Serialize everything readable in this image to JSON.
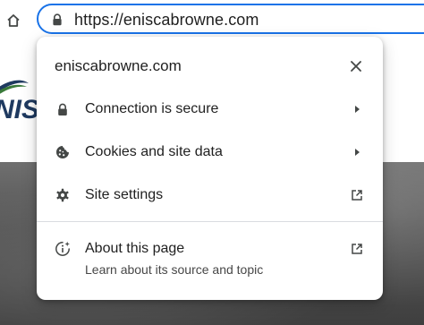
{
  "toolbar": {
    "home_icon": "home-icon",
    "lock_icon": "lock-icon",
    "url": "https://eniscabrowne.com",
    "accent": "#1a73e8"
  },
  "popup": {
    "title": "eniscabrowne.com",
    "close_icon": "close-icon",
    "rows": [
      {
        "label": "Connection is secure",
        "icon": "lock-icon",
        "trailing": "arrow-right-icon"
      },
      {
        "label": "Cookies and site data",
        "icon": "cookie-icon",
        "trailing": "arrow-right-icon"
      },
      {
        "label": "Site settings",
        "icon": "gear-icon",
        "trailing": "external-link-icon"
      }
    ],
    "about": {
      "label": "About this page",
      "sublabel": "Learn about its source and topic",
      "icon": "info-sparkle-icon",
      "trailing": "external-link-icon"
    }
  }
}
